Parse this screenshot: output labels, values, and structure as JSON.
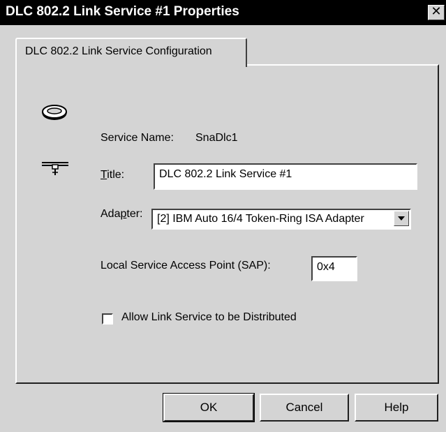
{
  "window": {
    "title": "DLC 802.2 Link Service #1 Properties",
    "close_glyph": "✕"
  },
  "tabs": [
    {
      "label": "DLC 802.2 Link Service Configuration",
      "selected": true
    }
  ],
  "form": {
    "service_name_label": "Service Name:",
    "service_name_value": "SnaDlc1",
    "title_label_mnemonic": "T",
    "title_label_rest": "itle:",
    "title_value": "DLC 802.2 Link Service #1",
    "adapter_label_pre": "Ada",
    "adapter_label_mnemonic": "p",
    "adapter_label_post": "ter:",
    "adapter_value": "[2] IBM Auto 16/4 Token-Ring ISA Adapter",
    "sap_label": "Local Service Access Point (SAP):",
    "sap_value": "0x4",
    "distributed_label": "Allow Link Service to be Distributed",
    "distributed_checked": false
  },
  "buttons": {
    "ok": "OK",
    "cancel": "Cancel",
    "help": "Help"
  },
  "icons": {
    "ring": "token-ring-icon",
    "network": "network-tap-icon"
  }
}
